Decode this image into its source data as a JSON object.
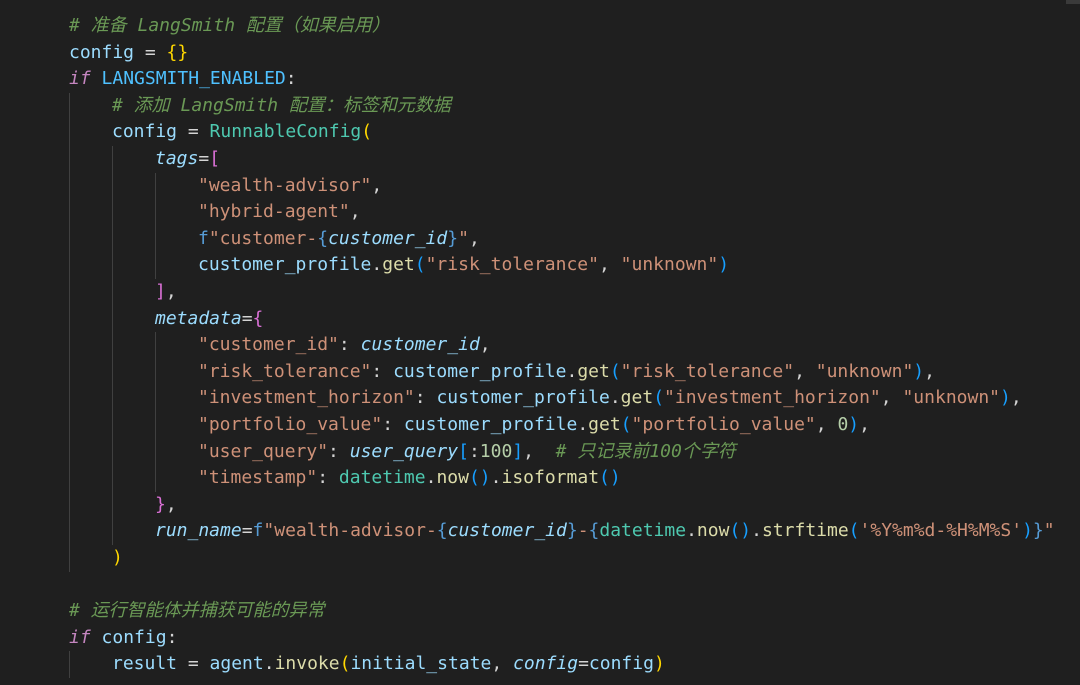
{
  "editor": {
    "language": "python",
    "theme_background": "#1f1f1f",
    "lines": [
      {
        "indent": 0,
        "tokens": [
          [
            "cmt",
            "# 准备 LangSmith 配置（如果启用）"
          ]
        ]
      },
      {
        "indent": 0,
        "tokens": [
          [
            "var",
            "config"
          ],
          [
            "op",
            " = "
          ],
          [
            "b1",
            "{}"
          ]
        ]
      },
      {
        "indent": 0,
        "tokens": [
          [
            "ctl",
            "if"
          ],
          [
            "op",
            " "
          ],
          [
            "const",
            "LANGSMITH_ENABLED"
          ],
          [
            "pun",
            ":"
          ]
        ]
      },
      {
        "indent": 1,
        "tokens": [
          [
            "cmt",
            "# 添加 LangSmith 配置：标签和元数据"
          ]
        ]
      },
      {
        "indent": 1,
        "tokens": [
          [
            "var",
            "config"
          ],
          [
            "op",
            " = "
          ],
          [
            "cls",
            "RunnableConfig"
          ],
          [
            "b1",
            "("
          ]
        ]
      },
      {
        "indent": 2,
        "tokens": [
          [
            "param",
            "tags"
          ],
          [
            "op",
            "="
          ],
          [
            "b2",
            "["
          ]
        ]
      },
      {
        "indent": 3,
        "tokens": [
          [
            "str",
            "\"wealth-advisor\""
          ],
          [
            "pun",
            ","
          ]
        ]
      },
      {
        "indent": 3,
        "tokens": [
          [
            "str",
            "\"hybrid-agent\""
          ],
          [
            "pun",
            ","
          ]
        ]
      },
      {
        "indent": 3,
        "tokens": [
          [
            "kw",
            "f"
          ],
          [
            "str",
            "\"customer-"
          ],
          [
            "kw",
            "{"
          ],
          [
            "ivar",
            "customer_id"
          ],
          [
            "kw",
            "}"
          ],
          [
            "str",
            "\""
          ],
          [
            "pun",
            ","
          ]
        ]
      },
      {
        "indent": 3,
        "tokens": [
          [
            "var",
            "customer_profile"
          ],
          [
            "pun",
            "."
          ],
          [
            "fn",
            "get"
          ],
          [
            "b3",
            "("
          ],
          [
            "str",
            "\"risk_tolerance\""
          ],
          [
            "pun",
            ", "
          ],
          [
            "str",
            "\"unknown\""
          ],
          [
            "b3",
            ")"
          ]
        ]
      },
      {
        "indent": 2,
        "tokens": [
          [
            "b2",
            "]"
          ],
          [
            "pun",
            ","
          ]
        ]
      },
      {
        "indent": 2,
        "tokens": [
          [
            "param",
            "metadata"
          ],
          [
            "op",
            "="
          ],
          [
            "b2",
            "{"
          ]
        ]
      },
      {
        "indent": 3,
        "tokens": [
          [
            "str",
            "\"customer_id\""
          ],
          [
            "pun",
            ": "
          ],
          [
            "ivar",
            "customer_id"
          ],
          [
            "pun",
            ","
          ]
        ]
      },
      {
        "indent": 3,
        "tokens": [
          [
            "str",
            "\"risk_tolerance\""
          ],
          [
            "pun",
            ": "
          ],
          [
            "var",
            "customer_profile"
          ],
          [
            "pun",
            "."
          ],
          [
            "fn",
            "get"
          ],
          [
            "b3",
            "("
          ],
          [
            "str",
            "\"risk_tolerance\""
          ],
          [
            "pun",
            ", "
          ],
          [
            "str",
            "\"unknown\""
          ],
          [
            "b3",
            ")"
          ],
          [
            "pun",
            ","
          ]
        ]
      },
      {
        "indent": 3,
        "tokens": [
          [
            "str",
            "\"investment_horizon\""
          ],
          [
            "pun",
            ": "
          ],
          [
            "var",
            "customer_profile"
          ],
          [
            "pun",
            "."
          ],
          [
            "fn",
            "get"
          ],
          [
            "b3",
            "("
          ],
          [
            "str",
            "\"investment_horizon\""
          ],
          [
            "pun",
            ", "
          ],
          [
            "str",
            "\"unknown\""
          ],
          [
            "b3",
            ")"
          ],
          [
            "pun",
            ","
          ]
        ]
      },
      {
        "indent": 3,
        "tokens": [
          [
            "str",
            "\"portfolio_value\""
          ],
          [
            "pun",
            ": "
          ],
          [
            "var",
            "customer_profile"
          ],
          [
            "pun",
            "."
          ],
          [
            "fn",
            "get"
          ],
          [
            "b3",
            "("
          ],
          [
            "str",
            "\"portfolio_value\""
          ],
          [
            "pun",
            ", "
          ],
          [
            "num",
            "0"
          ],
          [
            "b3",
            ")"
          ],
          [
            "pun",
            ","
          ]
        ]
      },
      {
        "indent": 3,
        "tokens": [
          [
            "str",
            "\"user_query\""
          ],
          [
            "pun",
            ": "
          ],
          [
            "ivar",
            "user_query"
          ],
          [
            "b3",
            "["
          ],
          [
            "pun",
            ":"
          ],
          [
            "num",
            "100"
          ],
          [
            "b3",
            "]"
          ],
          [
            "pun",
            ",  "
          ],
          [
            "cmt",
            "# 只记录前100个字符"
          ]
        ]
      },
      {
        "indent": 3,
        "tokens": [
          [
            "str",
            "\"timestamp\""
          ],
          [
            "pun",
            ": "
          ],
          [
            "cls",
            "datetime"
          ],
          [
            "pun",
            "."
          ],
          [
            "fn",
            "now"
          ],
          [
            "b3",
            "()"
          ],
          [
            "pun",
            "."
          ],
          [
            "fn",
            "isoformat"
          ],
          [
            "b3",
            "()"
          ]
        ]
      },
      {
        "indent": 2,
        "tokens": [
          [
            "b2",
            "}"
          ],
          [
            "pun",
            ","
          ]
        ]
      },
      {
        "indent": 2,
        "tokens": [
          [
            "param",
            "run_name"
          ],
          [
            "op",
            "="
          ],
          [
            "kw",
            "f"
          ],
          [
            "str",
            "\"wealth-advisor-"
          ],
          [
            "kw",
            "{"
          ],
          [
            "ivar",
            "customer_id"
          ],
          [
            "kw",
            "}"
          ],
          [
            "str",
            "-"
          ],
          [
            "kw",
            "{"
          ],
          [
            "cls",
            "datetime"
          ],
          [
            "pun",
            "."
          ],
          [
            "fn",
            "now"
          ],
          [
            "b3",
            "()"
          ],
          [
            "pun",
            "."
          ],
          [
            "fn",
            "strftime"
          ],
          [
            "b3",
            "("
          ],
          [
            "str",
            "'%Y%m%d-%H%M%S'"
          ],
          [
            "b3",
            ")"
          ],
          [
            "kw",
            "}"
          ],
          [
            "str",
            "\""
          ]
        ]
      },
      {
        "indent": 1,
        "tokens": [
          [
            "b1",
            ")"
          ]
        ]
      },
      {
        "indent": 0,
        "tokens": []
      },
      {
        "indent": 0,
        "tokens": [
          [
            "cmt",
            "# 运行智能体并捕获可能的异常"
          ]
        ]
      },
      {
        "indent": 0,
        "tokens": [
          [
            "ctl",
            "if"
          ],
          [
            "op",
            " "
          ],
          [
            "var",
            "config"
          ],
          [
            "pun",
            ":"
          ]
        ]
      },
      {
        "indent": 1,
        "tokens": [
          [
            "var",
            "result"
          ],
          [
            "op",
            " = "
          ],
          [
            "var",
            "agent"
          ],
          [
            "pun",
            "."
          ],
          [
            "fn",
            "invoke"
          ],
          [
            "b1",
            "("
          ],
          [
            "var",
            "initial_state"
          ],
          [
            "pun",
            ", "
          ],
          [
            "param",
            "config"
          ],
          [
            "op",
            "="
          ],
          [
            "var",
            "config"
          ],
          [
            "b1",
            ")"
          ]
        ]
      }
    ]
  }
}
